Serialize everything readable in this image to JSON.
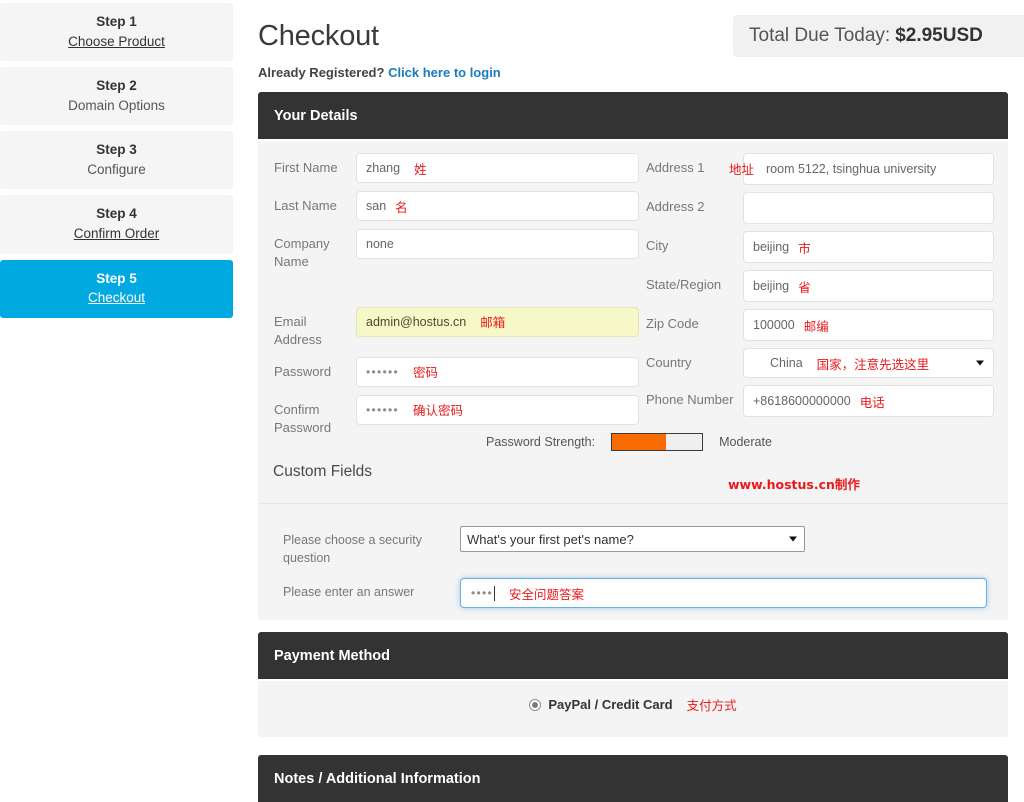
{
  "sidebar": {
    "steps": [
      {
        "num": "Step 1",
        "label": "Choose Product",
        "underline": true,
        "active": false
      },
      {
        "num": "Step 2",
        "label": "Domain Options",
        "underline": false,
        "active": false
      },
      {
        "num": "Step 3",
        "label": "Configure",
        "underline": false,
        "active": false
      },
      {
        "num": "Step 4",
        "label": "Confirm Order",
        "underline": true,
        "active": false
      },
      {
        "num": "Step 5",
        "label": "Checkout",
        "underline": true,
        "active": true
      }
    ]
  },
  "header": {
    "title": "Checkout",
    "total_label": "Total Due Today:",
    "total_amount": "$2.95USD",
    "registered_text": "Already Registered?",
    "login_link": "Click here to login"
  },
  "panels": {
    "details_title": "Your Details",
    "payment_title": "Payment Method",
    "notes_title": "Notes / Additional Information"
  },
  "details": {
    "left": [
      {
        "label": "First Name",
        "value": "zhang",
        "zh": "姓",
        "type": "text"
      },
      {
        "label": "Last Name",
        "value": "san",
        "zh": "名",
        "type": "text"
      },
      {
        "label": "Company Name",
        "value": "none",
        "zh": "",
        "type": "text"
      },
      {
        "label": "Email Address",
        "value": "admin@hostus.cn",
        "zh": "邮箱",
        "type": "autofill"
      },
      {
        "label": "Password",
        "value": "••••••",
        "zh": "密码",
        "type": "password"
      },
      {
        "label": "Confirm Password",
        "value": "••••••",
        "zh": "确认密码",
        "type": "password"
      }
    ],
    "right": [
      {
        "label": "Address 1",
        "value": "room 5122, tsinghua university",
        "zh": "地址",
        "zh_on_label": true,
        "type": "text"
      },
      {
        "label": "Address 2",
        "value": "",
        "zh": "",
        "zh_on_label": false,
        "type": "text"
      },
      {
        "label": "City",
        "value": "beijing",
        "zh": "市",
        "zh_on_label": false,
        "type": "text"
      },
      {
        "label": "State/Region",
        "value": "beijing",
        "zh": "省",
        "zh_on_label": false,
        "type": "text"
      },
      {
        "label": "Zip Code",
        "value": "100000",
        "zh": "邮编",
        "zh_on_label": false,
        "type": "text"
      },
      {
        "label": "Country",
        "value": "China",
        "zh": "国家，注意先选这里",
        "zh_on_label": false,
        "type": "select"
      },
      {
        "label": "Phone Number",
        "value": "+8618600000000",
        "zh": "电话",
        "zh_on_label": false,
        "type": "text"
      }
    ]
  },
  "password_strength": {
    "label": "Password Strength:",
    "level_text": "Moderate",
    "percent": 60,
    "fill_color": "#f76b00"
  },
  "custom_fields": {
    "title": "Custom Fields",
    "watermark": "www.hostus.cn制作",
    "question_label": "Please choose a security question",
    "question_value": "What's your first pet's name?",
    "answer_label": "Please enter an answer",
    "answer_value": "••••",
    "answer_zh": "安全问题答案"
  },
  "payment": {
    "option_label": "PayPal / Credit Card",
    "option_zh": "支付方式",
    "selected": true
  },
  "colors": {
    "accent": "#00a9e0",
    "panel_header": "#333333",
    "panel_body": "#f4f4f4",
    "annotation_red": "#e8191c",
    "link_blue": "#1a7bbd"
  }
}
